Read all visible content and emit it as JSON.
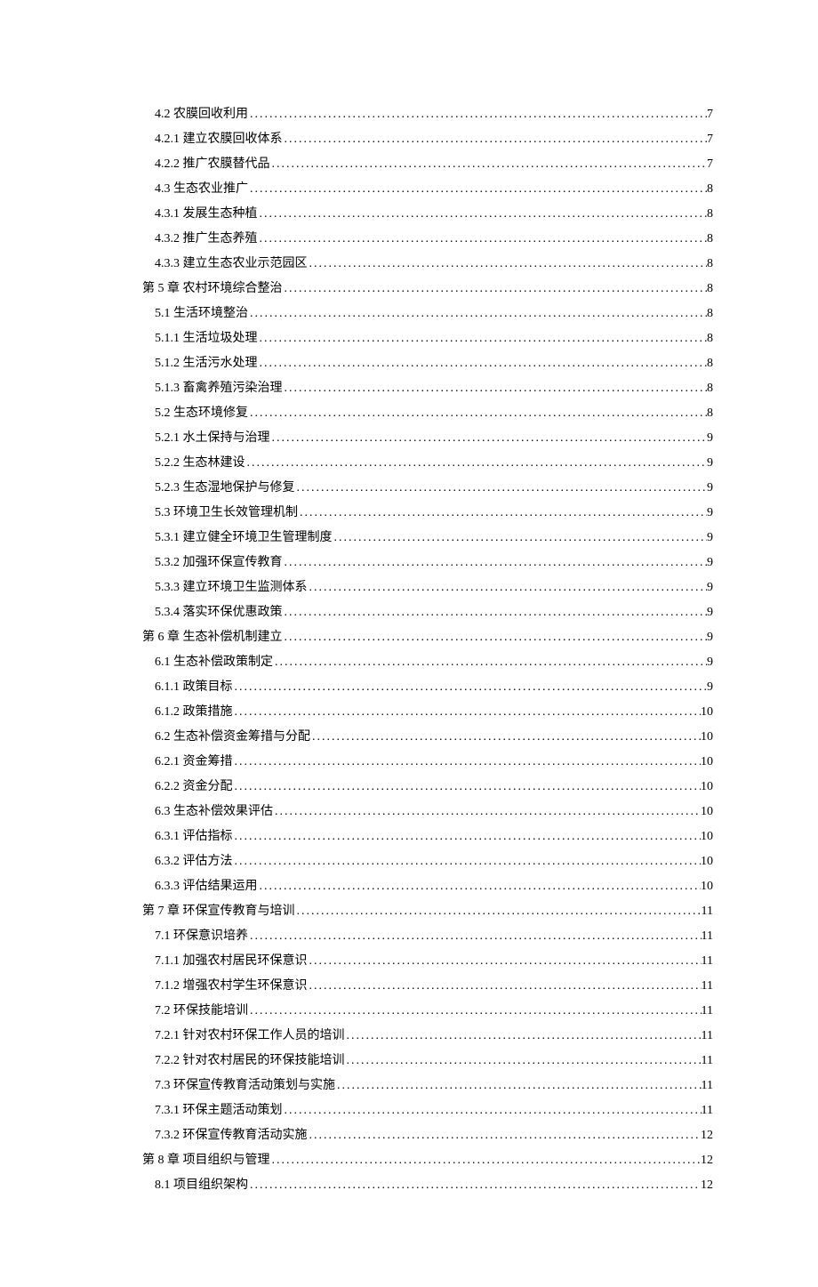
{
  "toc": [
    {
      "level": 2,
      "label": "4.2 农膜回收利用",
      "page": "7"
    },
    {
      "level": 2,
      "label": "4.2.1 建立农膜回收体系",
      "page": "7"
    },
    {
      "level": 2,
      "label": "4.2.2 推广农膜替代品",
      "page": "7"
    },
    {
      "level": 2,
      "label": "4.3 生态农业推广",
      "page": "8"
    },
    {
      "level": 2,
      "label": "4.3.1 发展生态种植",
      "page": "8"
    },
    {
      "level": 2,
      "label": "4.3.2 推广生态养殖",
      "page": "8"
    },
    {
      "level": 2,
      "label": "4.3.3 建立生态农业示范园区",
      "page": "8"
    },
    {
      "level": 1,
      "label": "第 5 章 农村环境综合整治",
      "page": "8"
    },
    {
      "level": 2,
      "label": "5.1 生活环境整治",
      "page": "8"
    },
    {
      "level": 2,
      "label": "5.1.1 生活垃圾处理",
      "page": "8"
    },
    {
      "level": 2,
      "label": "5.1.2 生活污水处理",
      "page": "8"
    },
    {
      "level": 2,
      "label": "5.1.3 畜禽养殖污染治理",
      "page": "8"
    },
    {
      "level": 2,
      "label": "5.2 生态环境修复",
      "page": "8"
    },
    {
      "level": 2,
      "label": "5.2.1 水土保持与治理",
      "page": "9"
    },
    {
      "level": 2,
      "label": "5.2.2 生态林建设",
      "page": "9"
    },
    {
      "level": 2,
      "label": "5.2.3 生态湿地保护与修复",
      "page": "9"
    },
    {
      "level": 2,
      "label": "5.3 环境卫生长效管理机制",
      "page": "9"
    },
    {
      "level": 2,
      "label": "5.3.1 建立健全环境卫生管理制度",
      "page": "9"
    },
    {
      "level": 2,
      "label": "5.3.2 加强环保宣传教育",
      "page": "9"
    },
    {
      "level": 2,
      "label": "5.3.3 建立环境卫生监测体系",
      "page": "9"
    },
    {
      "level": 2,
      "label": "5.3.4 落实环保优惠政策",
      "page": "9"
    },
    {
      "level": 1,
      "label": "第 6 章 生态补偿机制建立",
      "page": "9"
    },
    {
      "level": 2,
      "label": "6.1 生态补偿政策制定",
      "page": "9"
    },
    {
      "level": 2,
      "label": "6.1.1 政策目标",
      "page": "9"
    },
    {
      "level": 2,
      "label": "6.1.2 政策措施 ",
      "page": "10"
    },
    {
      "level": 2,
      "label": "6.2 生态补偿资金筹措与分配",
      "page": "10"
    },
    {
      "level": 2,
      "label": "6.2.1 资金筹措 ",
      "page": "10"
    },
    {
      "level": 2,
      "label": "6.2.2 资金分配 ",
      "page": "10"
    },
    {
      "level": 2,
      "label": "6.3 生态补偿效果评估",
      "page": "10"
    },
    {
      "level": 2,
      "label": "6.3.1 评估指标 ",
      "page": "10"
    },
    {
      "level": 2,
      "label": "6.3.2 评估方法 ",
      "page": "10"
    },
    {
      "level": 2,
      "label": "6.3.3 评估结果运用",
      "page": "10"
    },
    {
      "level": 1,
      "label": "第 7 章 环保宣传教育与培训",
      "page": "11"
    },
    {
      "level": 2,
      "label": "7.1 环保意识培养",
      "page": "11"
    },
    {
      "level": 2,
      "label": "7.1.1 加强农村居民环保意识",
      "page": "11"
    },
    {
      "level": 2,
      "label": "7.1.2 增强农村学生环保意识",
      "page": "11"
    },
    {
      "level": 2,
      "label": "7.2 环保技能培训",
      "page": "11"
    },
    {
      "level": 2,
      "label": "7.2.1 针对农村环保工作人员的培训",
      "page": "11"
    },
    {
      "level": 2,
      "label": "7.2.2 针对农村居民的环保技能培训",
      "page": "11"
    },
    {
      "level": 2,
      "label": "7.3 环保宣传教育活动策划与实施",
      "page": "11"
    },
    {
      "level": 2,
      "label": "7.3.1 环保主题活动策划 ",
      "page": "11"
    },
    {
      "level": 2,
      "label": "7.3.2 环保宣传教育活动实施",
      "page": "12"
    },
    {
      "level": 1,
      "label": "第 8 章 项目组织与管理",
      "page": "12"
    },
    {
      "level": 2,
      "label": "8.1 项目组织架构",
      "page": "12"
    }
  ]
}
